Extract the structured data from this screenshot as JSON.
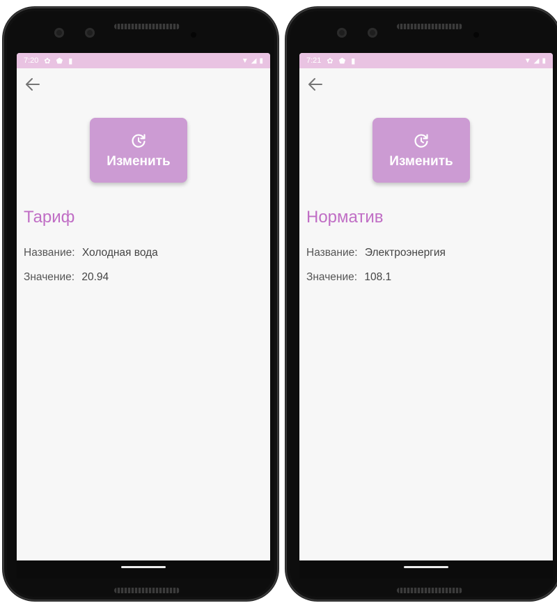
{
  "screens": [
    {
      "status_time": "7:20",
      "button_label": "Изменить",
      "section_title": "Тариф",
      "fields": [
        {
          "label": "Название:",
          "value": "Холодная вода"
        },
        {
          "label": "Значение:",
          "value": "20.94"
        }
      ]
    },
    {
      "status_time": "7:21",
      "button_label": "Изменить",
      "section_title": "Норматив",
      "fields": [
        {
          "label": "Название:",
          "value": "Электроэнергия"
        },
        {
          "label": "Значение:",
          "value": "108.1"
        }
      ]
    }
  ],
  "icons": {
    "back": "arrow-left-icon",
    "edit": "update-clock-icon",
    "status": [
      "gear-icon",
      "shield-icon",
      "sim-card-icon",
      "wifi-icon",
      "signal-icon",
      "battery-icon"
    ]
  },
  "colors": {
    "accent": "#cc9bd3",
    "title": "#c06ec5",
    "status_bar": "#e9c3e2",
    "screen_bg": "#f7f7f7"
  }
}
